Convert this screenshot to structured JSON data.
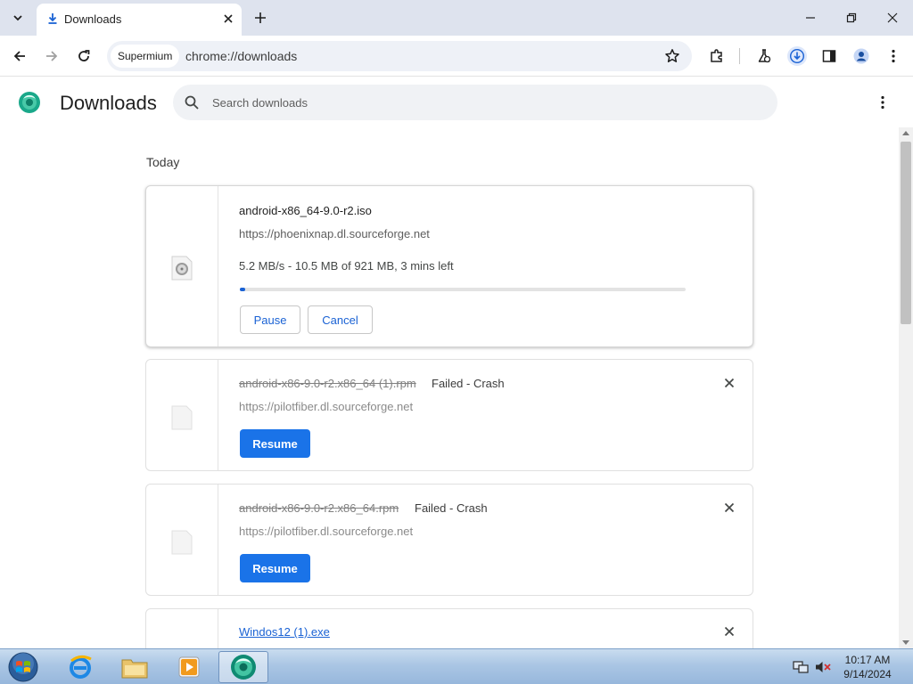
{
  "browser": {
    "tab_title": "Downloads",
    "origin_chip": "Supermium",
    "url": "chrome://downloads"
  },
  "page": {
    "title": "Downloads",
    "search_placeholder": "Search downloads",
    "date_header": "Today"
  },
  "downloads": [
    {
      "filename": "android-x86_64-9.0-r2.iso",
      "source": "https://phoenixnap.dl.sourceforge.net",
      "progress_text": "5.2 MB/s - 10.5 MB of 921 MB, 3 mins left",
      "progress_fraction": 0.011,
      "pause_label": "Pause",
      "cancel_label": "Cancel"
    },
    {
      "filename": "android-x86-9.0-r2.x86_64 (1).rpm",
      "status": "Failed - Crash",
      "source": "https://pilotfiber.dl.sourceforge.net",
      "resume_label": "Resume"
    },
    {
      "filename": "android-x86-9.0-r2.x86_64.rpm",
      "status": "Failed - Crash",
      "source": "https://pilotfiber.dl.sourceforge.net",
      "resume_label": "Resume"
    },
    {
      "filename": "Windos12 (1).exe"
    }
  ],
  "taskbar": {
    "time": "10:17 AM",
    "date": "9/14/2024"
  },
  "colors": {
    "accent": "#1a73e8",
    "link": "#1a62d4",
    "titlebar": "#dee3ee"
  }
}
